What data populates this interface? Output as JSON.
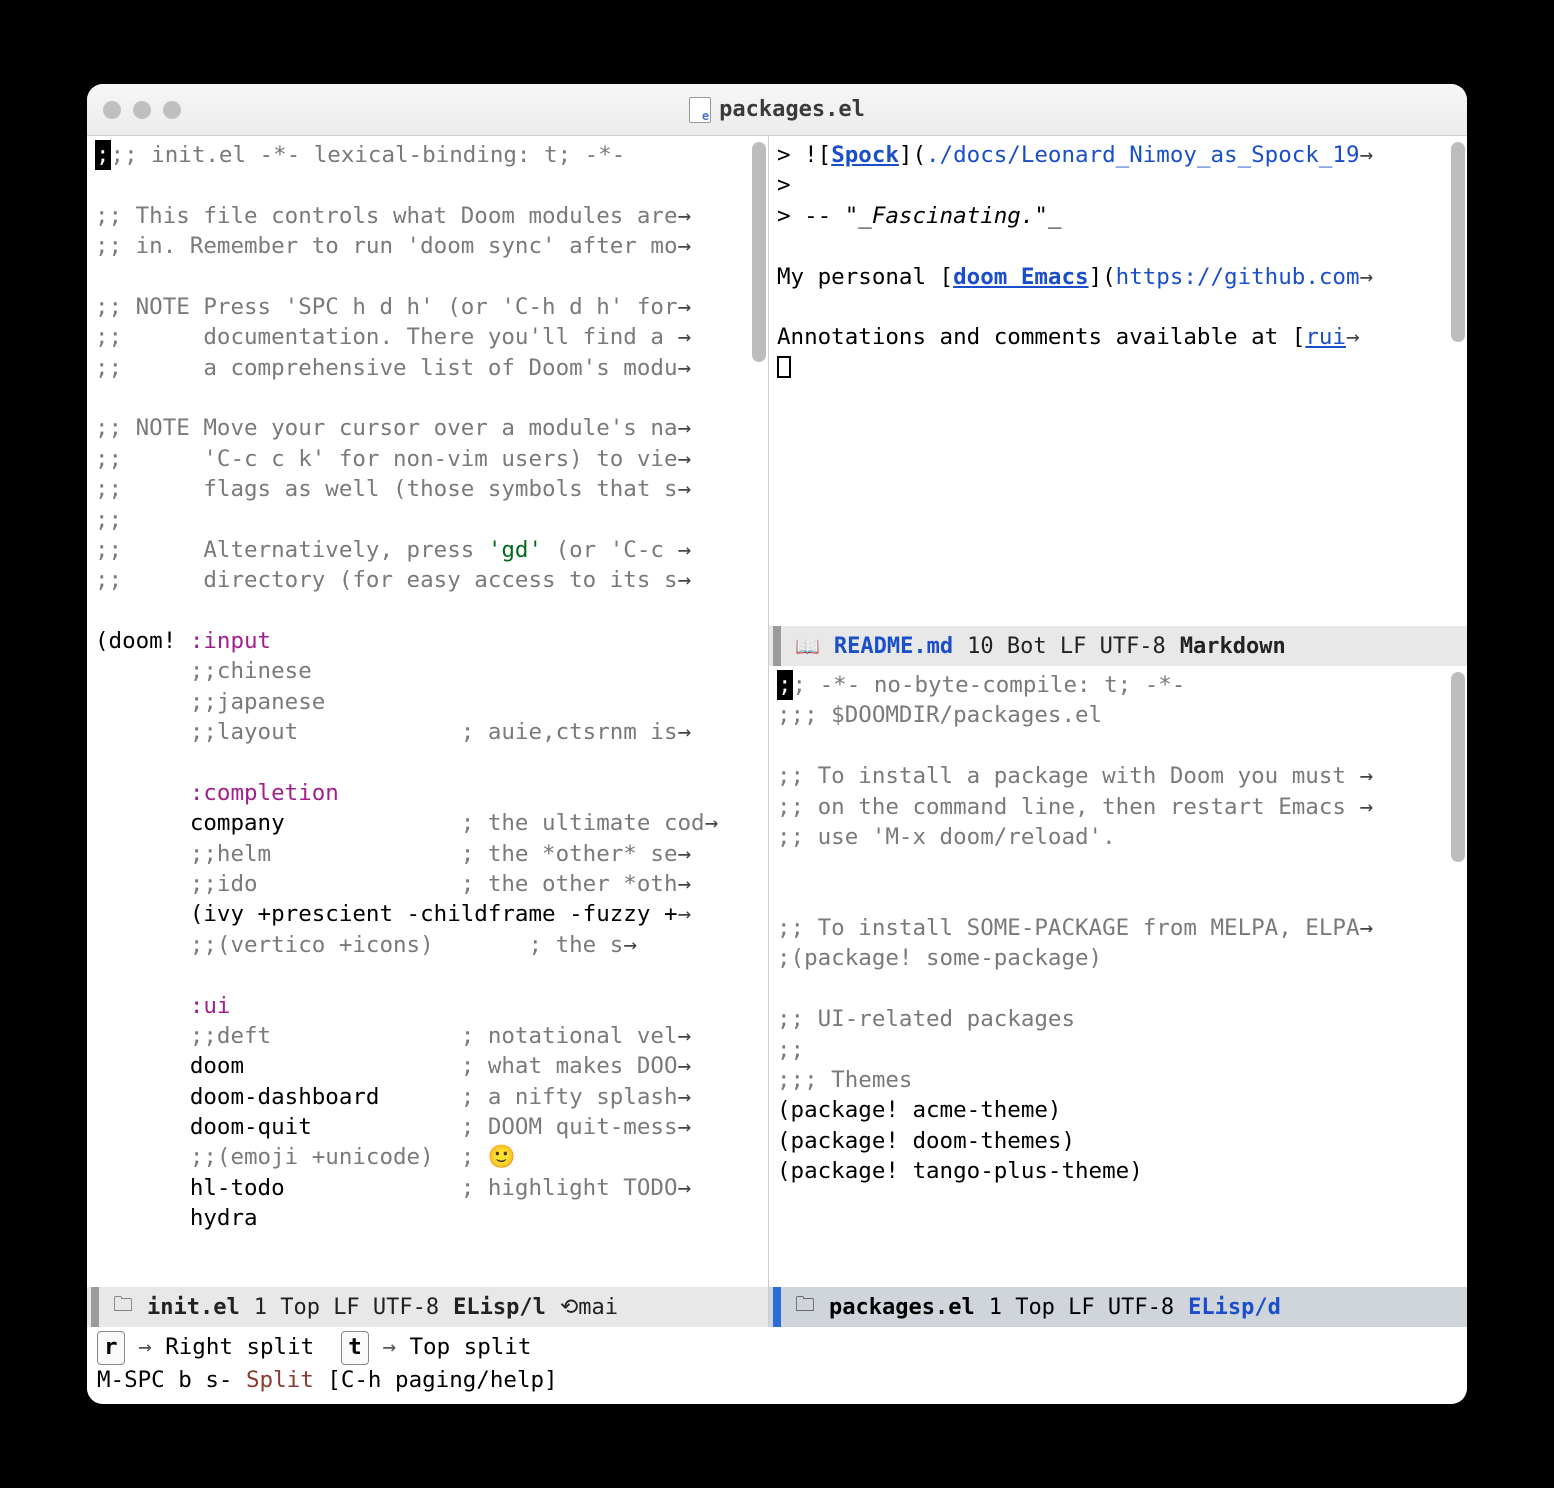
{
  "window": {
    "title": "packages.el"
  },
  "left": {
    "lines": {
      "l1a": ";",
      "l1b": ";; init.el -*- lexical-binding: t; -*-",
      "l3": ";; This file controls what Doom modules are",
      "l4": ";; in. Remember to run 'doom sync' after mo",
      "l6": ";; NOTE Press 'SPC h d h' (or 'C-h d h' for",
      "l7": ";;      documentation. There you'll find a ",
      "l8": ";;      a comprehensive list of Doom's modu",
      "l10": ";; NOTE Move your cursor over a module's na",
      "l11": ";;      'C-c c k' for non-vim users) to vie",
      "l12": ";;      flags as well (those symbols that s",
      "l13": ";;",
      "l14a": ";;      Alternatively, press ",
      "l14b": "'gd'",
      "l14c": " (or 'C-c ",
      "l15": ";;      directory (for easy access to its s",
      "doom": "(doom! ",
      "input": ":input",
      "l18": "       ;;chinese",
      "l19": "       ;;japanese",
      "l20a": "       ;;layout            ",
      "l20b": "; auie,ctsrnm is",
      "completion": ":completion",
      "l23a": "       company             ",
      "l23b": "; the ultimate cod",
      "l24a": "       ;;helm              ",
      "l24b": "; the *other* se",
      "l25a": "       ;;ido               ",
      "l25b": "; the other *oth",
      "l26": "       (ivy +prescient -childframe -fuzzy +",
      "l27a": "       ;;(vertico +icons)       ",
      "l27b": "; the s",
      "ui": ":ui",
      "l30a": "       ;;deft              ",
      "l30b": "; notational vel",
      "l31a": "       doom                ",
      "l31b": "; what makes DOO",
      "l32a": "       doom-dashboard      ",
      "l32b": "; a nifty splash",
      "l33a": "       doom-quit           ",
      "l33b": "; DOOM quit-mess",
      "l34a": "       ;;(emoji +unicode)  ",
      "l34b": "; ",
      "l34emoji": "🙂",
      "l35a": "       hl-todo             ",
      "l35b": "; highlight TODO",
      "l36": "       hydra"
    },
    "modeline": {
      "file": "init.el",
      "info": "1 Top LF UTF-8",
      "mode": "ELisp/l",
      "extra": "⟲mai"
    }
  },
  "rtop": {
    "lines": {
      "l1a": "> ![",
      "l1link": "Spock",
      "l1b": "](",
      "l1url": "./docs/Leonard_Nimoy_as_Spock_19",
      "l2": ">",
      "l3a": "> -- \"",
      "l3b": "_Fascinating.\"",
      "l3c": "_",
      "l5a": "My personal [",
      "l5link": "doom Emacs",
      "l5b": "](",
      "l5url": "https://github.com",
      "l7a": "Annotations and comments available at [",
      "l7link": "rui"
    },
    "modeline": {
      "icon": "📖",
      "file": "README.md",
      "info": "10 Bot LF UTF-8",
      "mode": "Markdown"
    }
  },
  "rbot": {
    "lines": {
      "l1a": ";",
      "l1b": "; -*- no-byte-compile: t; -*-",
      "l2": ";;; $DOOMDIR/packages.el",
      "l4": ";; To install a package with Doom you must ",
      "l5": ";; on the command line, then restart Emacs ",
      "l6": ";; use 'M-x doom/reload'.",
      "l9": ";; To install SOME-PACKAGE from MELPA, ELPA",
      "l10": ";(package! some-package)",
      "l12": ";; UI-related packages",
      "l13": ";;",
      "l14": ";;; Themes",
      "l15": "(package! acme-theme)",
      "l16": "(package! doom-themes)",
      "l17": "(package! tango-plus-theme)"
    },
    "modeline": {
      "file": "packages.el",
      "info": "1 Top LF UTF-8",
      "mode": "ELisp/d"
    }
  },
  "minibuf": {
    "k1": "r",
    "t1": "Right split",
    "k2": "t",
    "t2": "Top split",
    "line2a": "M-SPC b s- ",
    "line2b": "Split",
    "line2c": " [C-h paging/help]"
  }
}
